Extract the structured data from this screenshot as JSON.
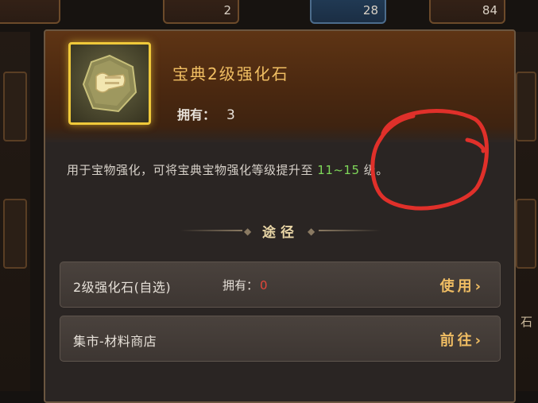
{
  "background": {
    "slot_counts": [
      "2",
      "28",
      "84"
    ],
    "side_label": "石"
  },
  "item": {
    "icon": "scroll-in-crystal-icon",
    "name": "宝典2级强化石",
    "owned_label": "拥有：",
    "owned_value": "3"
  },
  "description": {
    "prefix": "用于宝物强化，可将宝典宝物强化等级提升至 ",
    "highlight": "11~15",
    "suffix": " 级。"
  },
  "sources": {
    "title": "途径",
    "rows": [
      {
        "label": "2级强化石(自选)",
        "owned_label": "拥有：",
        "owned_value": "0",
        "action": "使用"
      },
      {
        "label": "集市-材料商店",
        "action": "前往"
      }
    ]
  },
  "colors": {
    "item_name": "#f1bf63",
    "highlight": "#7fd85a",
    "owned_zero": "#e4473a",
    "action": "#f0bd63",
    "frame": "#f0c93a",
    "annotation": "#e0302a"
  }
}
